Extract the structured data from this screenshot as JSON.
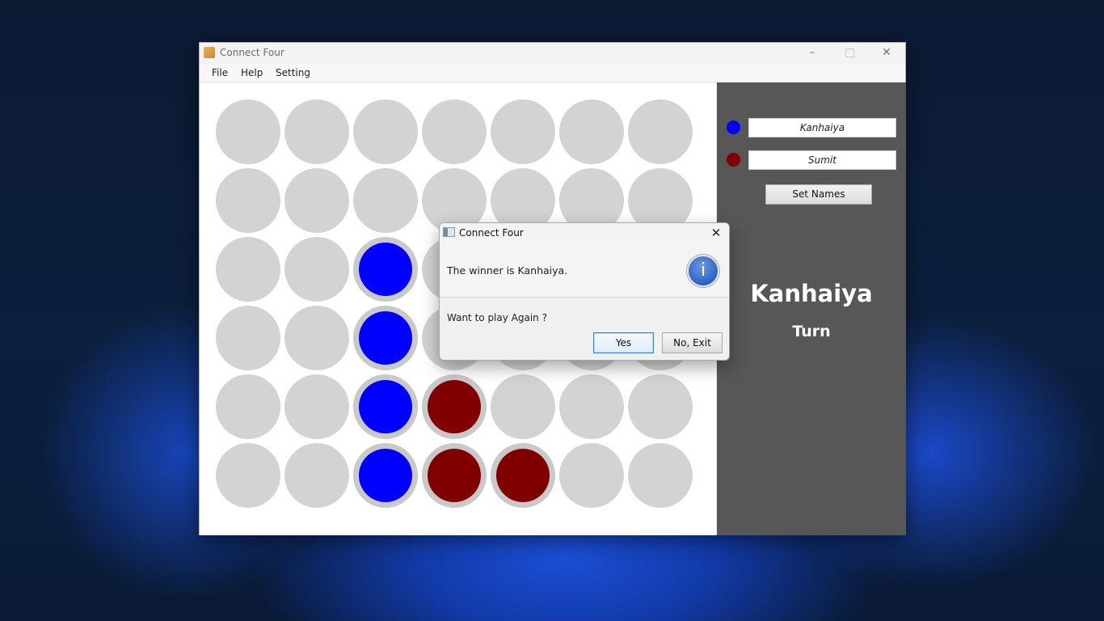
{
  "window": {
    "title": "Connect Four",
    "controls": {
      "minimize": "–",
      "close": "✕"
    }
  },
  "menu": [
    "File",
    "Help",
    "Setting"
  ],
  "colors": {
    "empty": "#d3d3d3",
    "player1": "#0000ff",
    "player2": "#800000",
    "ring": "#c9c9c9"
  },
  "board": {
    "rows": 6,
    "cols": 7,
    "grid": [
      [
        0,
        0,
        0,
        0,
        0,
        0,
        0
      ],
      [
        0,
        0,
        0,
        0,
        0,
        0,
        0
      ],
      [
        0,
        0,
        1,
        0,
        0,
        0,
        0
      ],
      [
        0,
        0,
        1,
        0,
        0,
        0,
        0
      ],
      [
        0,
        0,
        1,
        2,
        0,
        0,
        0
      ],
      [
        0,
        0,
        1,
        2,
        2,
        0,
        0
      ]
    ]
  },
  "side": {
    "player1_name": "Kanhaiya",
    "player2_name": "Sumit",
    "set_names_label": "Set Names",
    "turn_player": "Kanhaiya",
    "turn_label": "Turn"
  },
  "dialog": {
    "title": "Connect Four",
    "message": "The winner is Kanhaiya.",
    "question": "Want to play Again ?",
    "yes_label": "Yes",
    "no_label": "No, Exit",
    "info_glyph": "i",
    "close_glyph": "✕"
  }
}
